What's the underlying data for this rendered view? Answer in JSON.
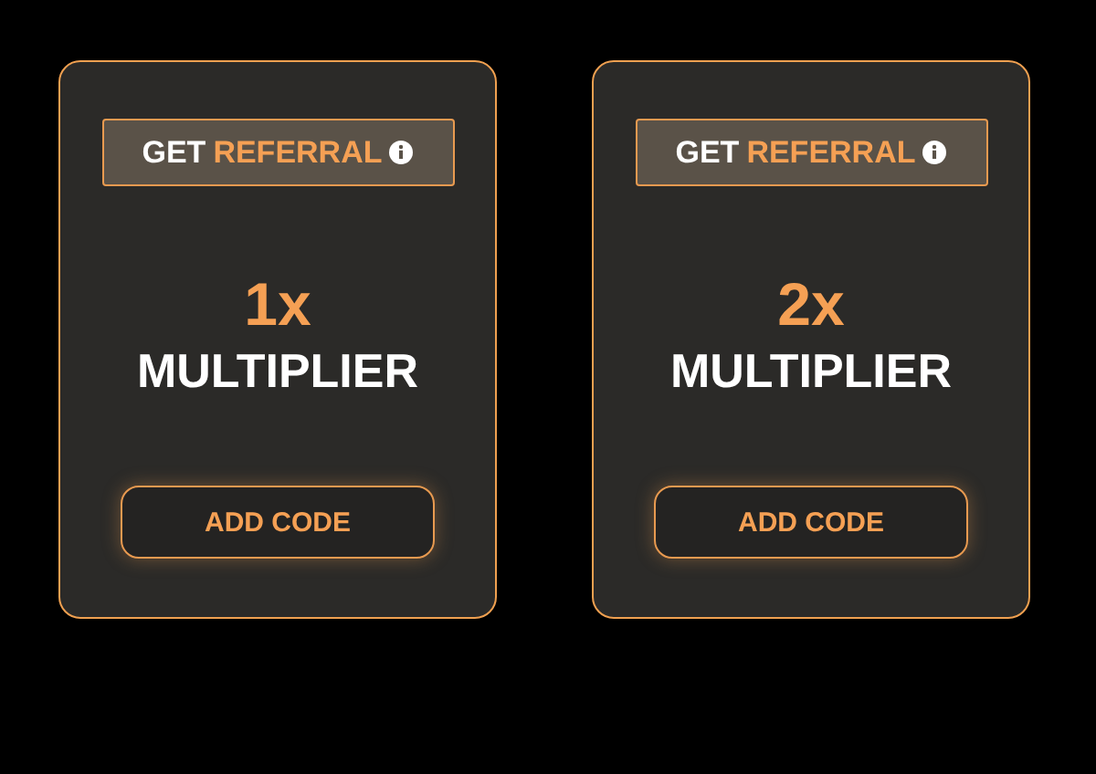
{
  "cards": [
    {
      "referral_button": {
        "prefix": "GET",
        "highlight": "REFERRAL"
      },
      "multiplier": "1x",
      "label": "MULTIPLIER",
      "add_button": "ADD CODE"
    },
    {
      "referral_button": {
        "prefix": "GET",
        "highlight": "REFERRAL"
      },
      "multiplier": "2x",
      "label": "MULTIPLIER",
      "add_button": "ADD CODE"
    }
  ]
}
